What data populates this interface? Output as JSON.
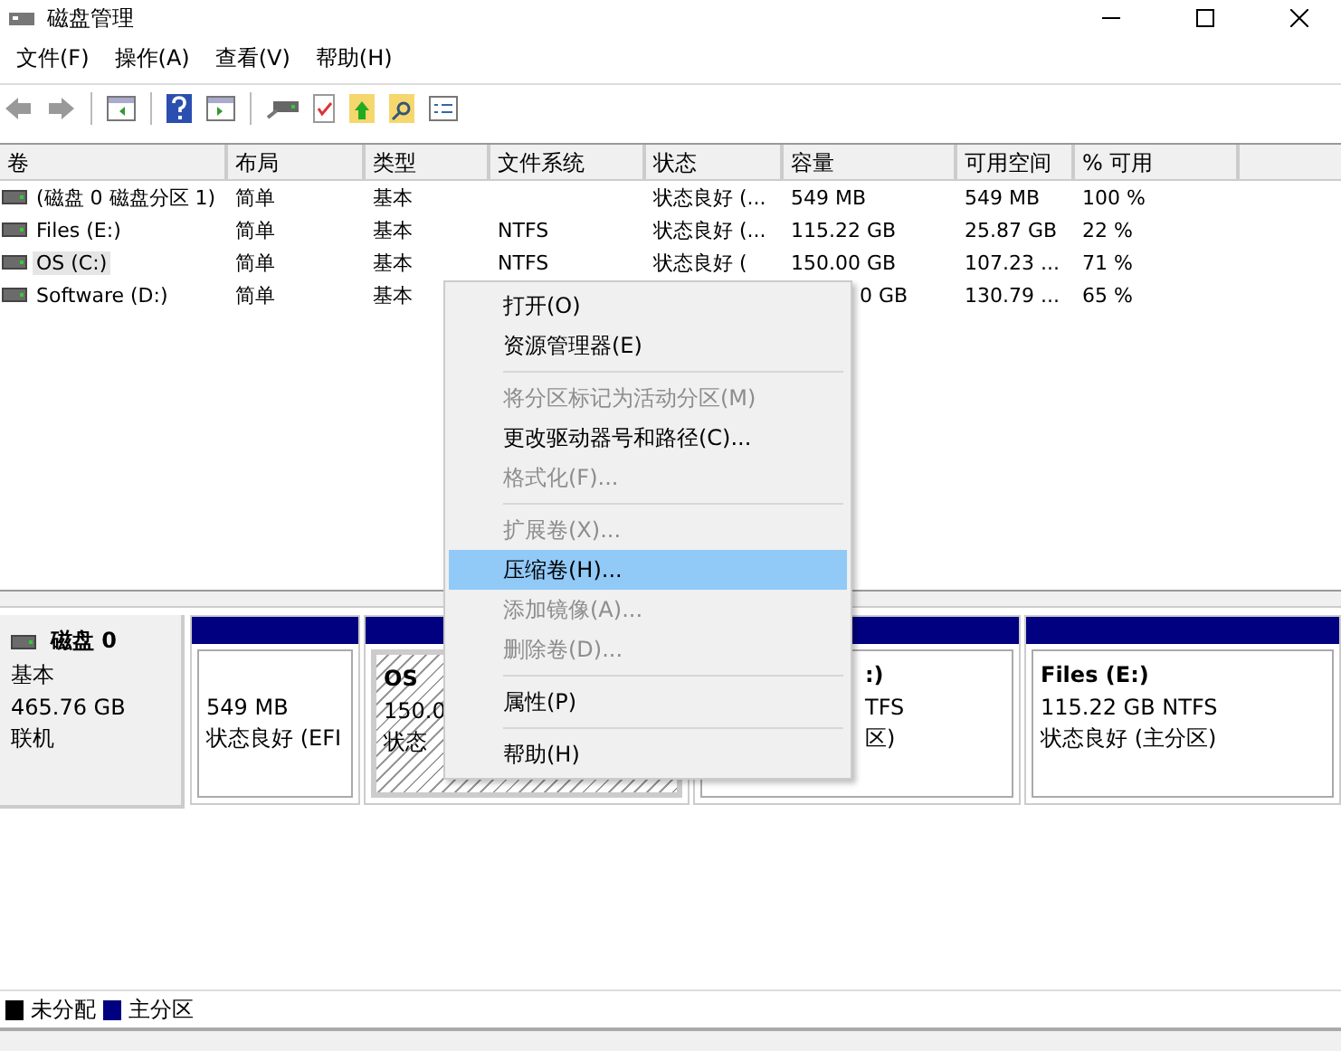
{
  "window": {
    "title": "磁盘管理"
  },
  "menu_bar": [
    "文件(F)",
    "操作(A)",
    "查看(V)",
    "帮助(H)"
  ],
  "volume_table": {
    "columns": [
      "卷",
      "布局",
      "类型",
      "文件系统",
      "状态",
      "容量",
      "可用空间",
      "% 可用"
    ],
    "rows": [
      {
        "selected": false,
        "cells": [
          "(磁盘 0 磁盘分区 1)",
          "简单",
          "基本",
          null,
          "状态良好 (...",
          "549 MB",
          "549 MB",
          "100 %"
        ]
      },
      {
        "selected": false,
        "cells": [
          "Files (E:)",
          "简单",
          "基本",
          "NTFS",
          "状态良好 (...",
          "115.22 GB",
          "25.87 GB",
          "22 %"
        ]
      },
      {
        "selected": true,
        "cells": [
          "OS (C:)",
          "简单",
          "基本",
          "NTFS",
          "状态良好 (",
          "150.00 GB",
          "107.23 ...",
          "71 %"
        ]
      },
      {
        "selected": false,
        "cells": [
          "Software (D:)",
          "简单",
          "基本",
          null,
          null,
          "0 GB",
          "130.79 ...",
          "65 %"
        ]
      }
    ]
  },
  "disk": {
    "name": "磁盘 0",
    "type": "基本",
    "size": "465.76 GB",
    "status": "联机",
    "partitions": [
      {
        "kind": "primary",
        "selected": false,
        "lines": [
          "549 MB",
          "状态良好 (EFI"
        ]
      },
      {
        "kind": "primary",
        "selected": true,
        "name": "OS",
        "lines": [
          "150.0",
          "状态"
        ]
      },
      {
        "kind": "primary",
        "selected": false,
        "name": ":)",
        "lines": [
          "TFS",
          "区)"
        ]
      },
      {
        "kind": "primary",
        "selected": false,
        "name": "Files  (E:)",
        "lines": [
          "115.22 GB NTFS",
          "状态良好 (主分区)"
        ]
      }
    ]
  },
  "legend": [
    {
      "label": "未分配",
      "color": "#000000"
    },
    {
      "label": "主分区",
      "color": "#000080"
    }
  ],
  "context_menu": [
    {
      "kind": "item",
      "label": "打开(O)",
      "disabled": false,
      "selected": false
    },
    {
      "kind": "item",
      "label": "资源管理器(E)",
      "disabled": false,
      "selected": false
    },
    {
      "kind": "separator"
    },
    {
      "kind": "item",
      "label": "将分区标记为活动分区(M)",
      "disabled": true,
      "selected": false
    },
    {
      "kind": "item",
      "label": "更改驱动器号和路径(C)...",
      "disabled": false,
      "selected": false
    },
    {
      "kind": "item",
      "label": "格式化(F)...",
      "disabled": true,
      "selected": false
    },
    {
      "kind": "separator"
    },
    {
      "kind": "item",
      "label": "扩展卷(X)...",
      "disabled": true,
      "selected": false
    },
    {
      "kind": "item",
      "label": "压缩卷(H)...",
      "disabled": false,
      "selected": true
    },
    {
      "kind": "item",
      "label": "添加镜像(A)...",
      "disabled": true,
      "selected": false
    },
    {
      "kind": "item",
      "label": "删除卷(D)...",
      "disabled": true,
      "selected": false
    },
    {
      "kind": "separator"
    },
    {
      "kind": "item",
      "label": "属性(P)",
      "disabled": false,
      "selected": false
    },
    {
      "kind": "separator"
    },
    {
      "kind": "item",
      "label": "帮助(H)",
      "disabled": false,
      "selected": false
    }
  ]
}
